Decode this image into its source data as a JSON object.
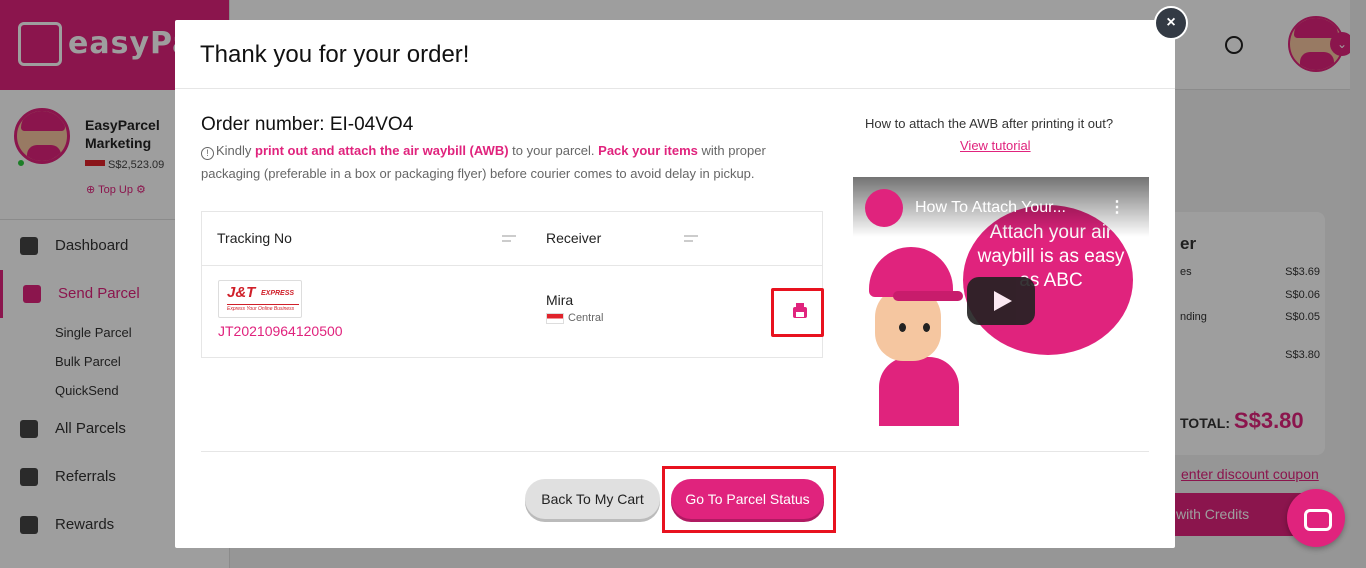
{
  "sidebar": {
    "brand": "easyParcel",
    "profile": {
      "name": "EasyParcel Marketing",
      "balance": "S$2,523.09",
      "topup_label": "Top Up"
    },
    "nav": [
      {
        "label": "Dashboard",
        "icon": "dashboard-icon"
      },
      {
        "label": "Send Parcel",
        "icon": "truck-icon"
      },
      {
        "label": "All Parcels",
        "icon": "boxes-icon"
      },
      {
        "label": "Referrals",
        "icon": "user-add-icon"
      },
      {
        "label": "Rewards",
        "icon": "gift-icon"
      }
    ],
    "send_parcel_sub": [
      "Single Parcel",
      "Bulk Parcel",
      "QuickSend"
    ]
  },
  "summary": {
    "title_partial": "er",
    "rows": [
      {
        "label": "es",
        "value": "S$3.69"
      },
      {
        "label": "",
        "value": "S$0.06"
      },
      {
        "label": "nding",
        "value": "S$0.05"
      },
      {
        "label": "",
        "value": "S$3.80"
      }
    ],
    "total_label": "TOTAL:",
    "total_value": "S$3.80",
    "coupon_label": "enter discount coupon",
    "pay_label": "with Credits"
  },
  "modal": {
    "title": "Thank you for your order!",
    "close_label": "×",
    "order_number": "Order number: EI-04VO4",
    "note": {
      "p1": "Kindly ",
      "h1": "print out and attach the air waybill (AWB)",
      "p2": " to your parcel. ",
      "h2": "Pack your items",
      "p3": " with proper packaging (preferable in a box or packaging flyer) before courier comes to avoid delay in pickup."
    },
    "table": {
      "headers": [
        "Tracking No",
        "Receiver"
      ],
      "row": {
        "courier_logo": "J&T",
        "courier_logo_sub": "EXPRESS",
        "courier_tagline": "Express Your Online Business",
        "tracking_no": "JT20210964120500",
        "receiver_name": "Mira",
        "receiver_region": "Central"
      }
    },
    "awb_question": "How to attach the AWB after printing it out?",
    "tutorial_link": "View tutorial",
    "video": {
      "title": "How To Attach Your...",
      "overlay_text": "Attach your air waybill is as easy as ABC"
    },
    "back_button": "Back To My Cart",
    "go_button": "Go To Parcel Status"
  },
  "colors": {
    "brand": "#e0237d",
    "highlight_frame": "#e8121f"
  }
}
